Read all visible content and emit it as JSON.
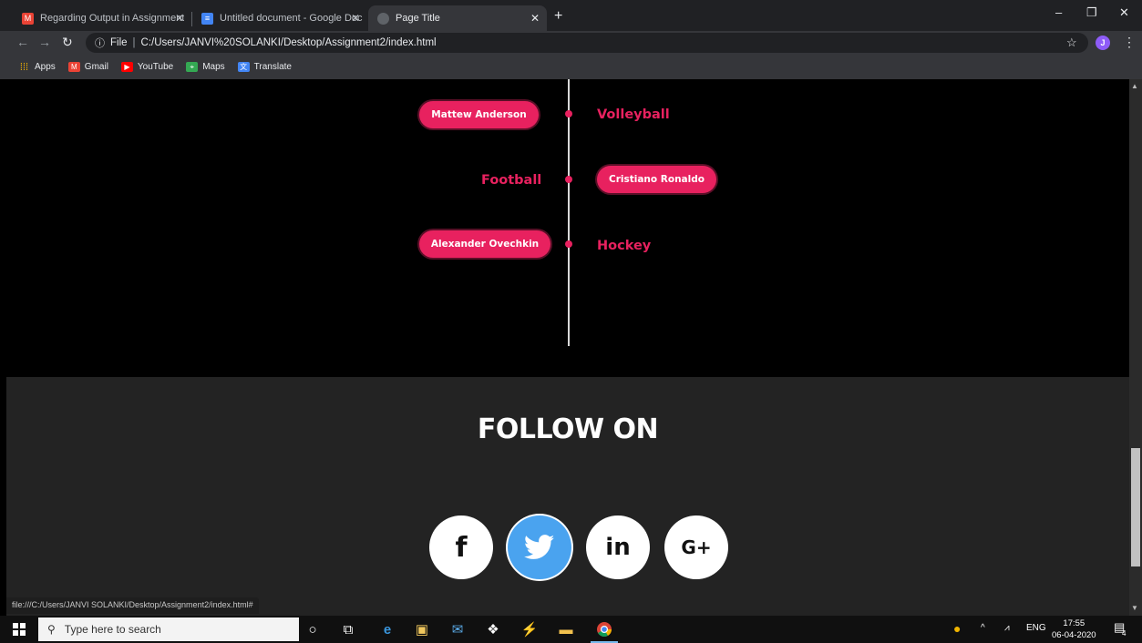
{
  "browser": {
    "tabs": [
      {
        "title": "Regarding Output in Assignment",
        "icon": "gmail-icon",
        "close": "✕"
      },
      {
        "title": "Untitled document - Google Doc",
        "icon": "docs-icon",
        "close": "✕"
      },
      {
        "title": "Page Title",
        "icon": "globe-icon",
        "close": "✕"
      }
    ],
    "new_tab": "+",
    "window_controls": {
      "minimize": "–",
      "maximize": "❐",
      "close": "✕"
    },
    "address": {
      "scheme_label": "File",
      "url": "C:/Users/JANVI%20SOLANKI/Desktop/Assignment2/index.html"
    },
    "profile_initial": "J",
    "bookmarks": [
      {
        "label": "Apps",
        "icon": "apps-grid-icon",
        "color": "#f4b400"
      },
      {
        "label": "Gmail",
        "icon": "gmail-icon",
        "color": "#ea4335"
      },
      {
        "label": "YouTube",
        "icon": "youtube-icon",
        "color": "#ff0000"
      },
      {
        "label": "Maps",
        "icon": "maps-icon",
        "color": "#34a853"
      },
      {
        "label": "Translate",
        "icon": "translate-icon",
        "color": "#4285f4"
      }
    ],
    "status_text": "file:///C:/Users/JANVI SOLANKI/Desktop/Assignment2/index.html#"
  },
  "page": {
    "accent_color": "#e8215f",
    "timeline": [
      {
        "player": "Mattew Anderson",
        "sport": "Volleyball",
        "player_side": "left"
      },
      {
        "player": "Cristiano Ronaldo",
        "sport": "Football",
        "player_side": "right"
      },
      {
        "player": "Alexander Ovechkin",
        "sport": "Hockey",
        "player_side": "left"
      }
    ],
    "follow": {
      "title": "FOLLOW ON",
      "links": [
        {
          "label": "f",
          "icon": "facebook-icon"
        },
        {
          "label": "",
          "icon": "twitter-icon",
          "color": "#4aa3ef"
        },
        {
          "label": "in",
          "icon": "linkedin-icon"
        },
        {
          "label": "G+",
          "icon": "google-plus-icon"
        }
      ]
    }
  },
  "taskbar": {
    "search_placeholder": "Type here to search",
    "tray_language": "ENG",
    "time": "17:55",
    "date": "06-04-2020",
    "notification_count": "4"
  }
}
